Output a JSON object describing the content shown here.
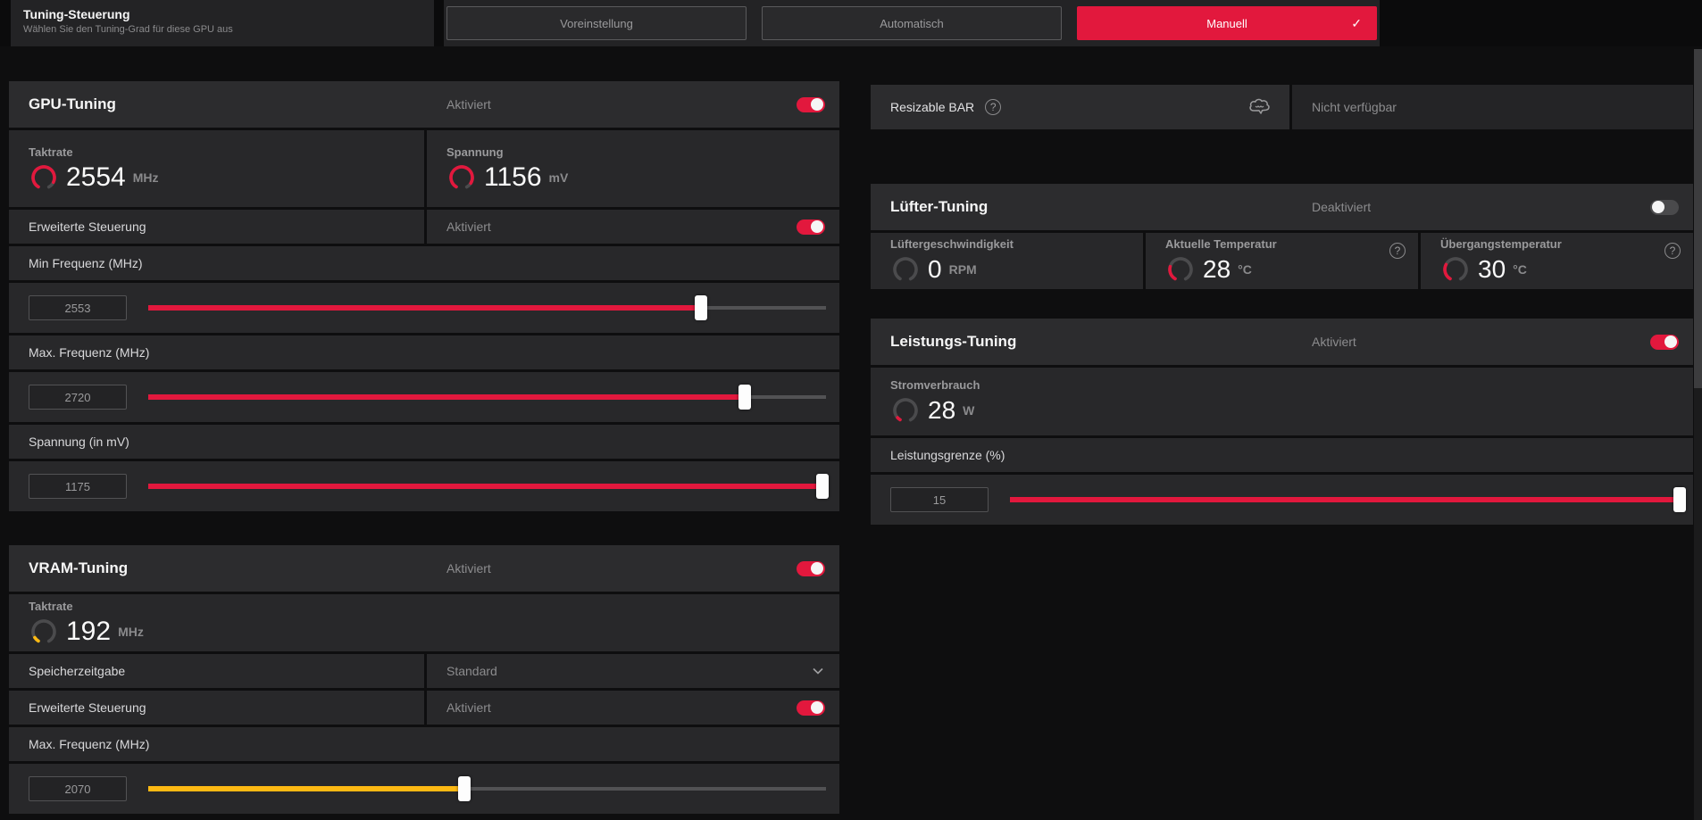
{
  "accent": "#e2183d",
  "yellow": "#fdb913",
  "icons": {
    "help_glyph": "?",
    "check_glyph": "✓"
  },
  "topbar": {
    "title": "Tuning-Steuerung",
    "subtitle": "Wählen Sie den Tuning-Grad für diese GPU aus",
    "buttons": [
      {
        "label": "Voreinstellung",
        "selected": false
      },
      {
        "label": "Automatisch",
        "selected": false
      },
      {
        "label": "Manuell",
        "selected": true
      }
    ]
  },
  "gpu": {
    "title": "GPU-Tuning",
    "status": "Aktiviert",
    "enabled": true,
    "stats": [
      {
        "label": "Taktrate",
        "value": "2554",
        "unit": "MHz",
        "fraction": 0.88,
        "color": "#e2183d"
      },
      {
        "label": "Spannung",
        "value": "1156",
        "unit": "mV",
        "fraction": 0.9,
        "color": "#e2183d"
      }
    ],
    "advanced": {
      "label": "Erweiterte Steuerung",
      "status": "Aktiviert",
      "enabled": true
    },
    "sliders": [
      {
        "label": "Min Frequenz (MHz)",
        "value": "2553",
        "fraction": 0.815,
        "color": "#e2183d"
      },
      {
        "label": "Max. Frequenz (MHz)",
        "value": "2720",
        "fraction": 0.88,
        "color": "#e2183d"
      },
      {
        "label": "Spannung (in mV)",
        "value": "1175",
        "fraction": 0.995,
        "color": "#e2183d"
      }
    ]
  },
  "vram": {
    "title": "VRAM-Tuning",
    "status": "Aktiviert",
    "enabled": true,
    "stat": {
      "label": "Taktrate",
      "value": "192",
      "unit": "MHz",
      "fraction": 0.09,
      "color": "#fdb913"
    },
    "timing": {
      "label": "Speicherzeitgabe",
      "value": "Standard"
    },
    "advanced": {
      "label": "Erweiterte Steuerung",
      "status": "Aktiviert",
      "enabled": true
    },
    "slider": {
      "label": "Max. Frequenz (MHz)",
      "value": "2070",
      "fraction": 0.466,
      "color": "#fdb913"
    }
  },
  "rebar": {
    "label": "Resizable BAR",
    "status": "Nicht verfügbar"
  },
  "fan": {
    "title": "Lüfter-Tuning",
    "status": "Deaktiviert",
    "enabled": false,
    "stats": [
      {
        "label": "Lüftergeschwindigkeit",
        "value": "0",
        "unit": "RPM",
        "fraction": 0,
        "color": "#e2183d",
        "help": false
      },
      {
        "label": "Aktuelle Temperatur",
        "value": "28",
        "unit": "°C",
        "fraction": 0.25,
        "color": "#e2183d",
        "help": true
      },
      {
        "label": "Übergangstemperatur",
        "value": "30",
        "unit": "°C",
        "fraction": 0.29,
        "color": "#e2183d",
        "help": true
      }
    ]
  },
  "power": {
    "title": "Leistungs-Tuning",
    "status": "Aktiviert",
    "enabled": true,
    "stat": {
      "label": "Stromverbrauch",
      "value": "28",
      "unit": "W",
      "fraction": 0.06,
      "color": "#e2183d"
    },
    "slider": {
      "label": "Leistungsgrenze (%)",
      "value": "15",
      "fraction": 1.0,
      "color": "#e2183d"
    }
  }
}
